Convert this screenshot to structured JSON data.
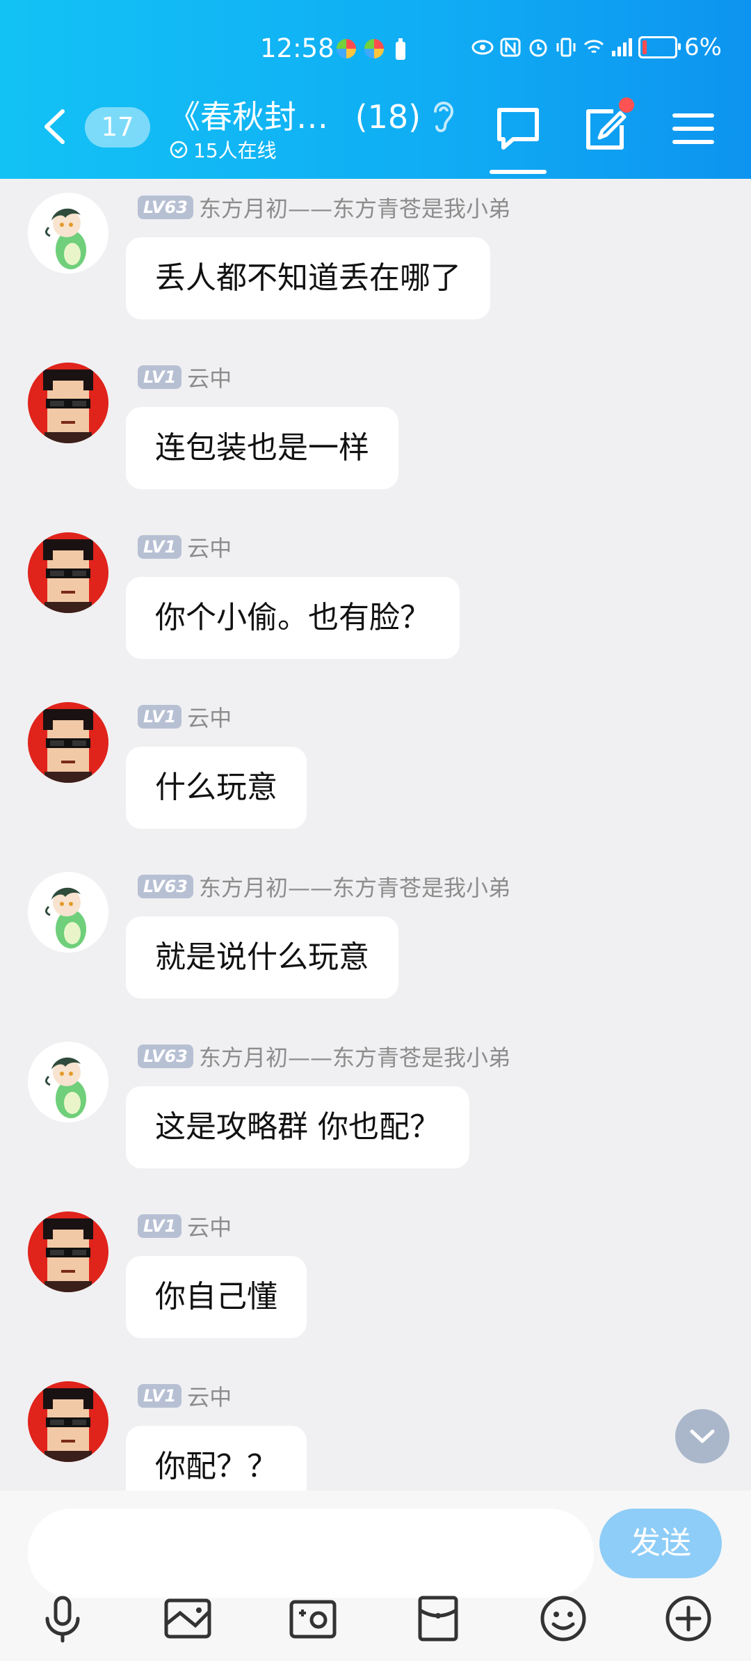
{
  "status_bar": {
    "time": "12:58",
    "battery": "6%"
  },
  "header": {
    "unread_count": "17",
    "title": "《春秋封…",
    "member_count": "(18)",
    "online_text": "15人在线"
  },
  "messages": [
    {
      "level": "LV63",
      "sender": "东方月初——东方青苍是我小弟",
      "text": "丢人都不知道丢在哪了",
      "avatar": "dragon"
    },
    {
      "level": "LV1",
      "sender": "云中",
      "text": "连包装也是一样",
      "avatar": "sunglasses"
    },
    {
      "level": "LV1",
      "sender": "云中",
      "text": "你个小偷。也有脸？",
      "avatar": "sunglasses"
    },
    {
      "level": "LV1",
      "sender": "云中",
      "text": "什么玩意",
      "avatar": "sunglasses"
    },
    {
      "level": "LV63",
      "sender": "东方月初——东方青苍是我小弟",
      "text": "就是说什么玩意",
      "avatar": "dragon"
    },
    {
      "level": "LV63",
      "sender": "东方月初——东方青苍是我小弟",
      "text": "这是攻略群  你也配？",
      "avatar": "dragon"
    },
    {
      "level": "LV1",
      "sender": "云中",
      "text": "你自己懂",
      "avatar": "sunglasses"
    },
    {
      "level": "LV1",
      "sender": "云中",
      "text": "你配？？",
      "avatar": "sunglasses"
    }
  ],
  "input": {
    "placeholder": "",
    "send_label": "发送"
  },
  "colors": {
    "header": "#10aef4",
    "send_button": "#8ecdf7",
    "notification_dot": "#ff5252"
  }
}
